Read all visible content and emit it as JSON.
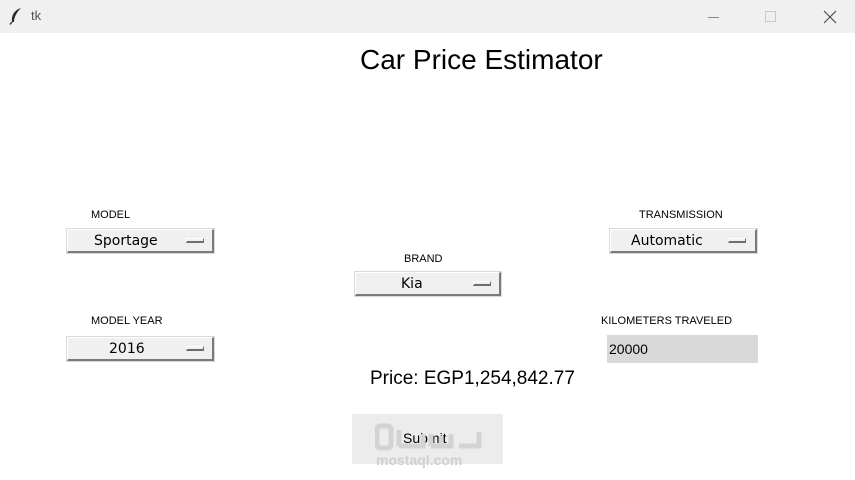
{
  "window": {
    "title": "tk"
  },
  "app": {
    "heading": "Car Price Estimator"
  },
  "fields": {
    "model": {
      "label": "MODEL",
      "value": "Sportage"
    },
    "model_year": {
      "label": "MODEL YEAR",
      "value": "2016"
    },
    "brand": {
      "label": "BRAND",
      "value": "Kia"
    },
    "transmission": {
      "label": "TRANSMISSION",
      "value": "Automatic"
    },
    "kilometers": {
      "label": "KILOMETERS TRAVELED",
      "value": "20000"
    }
  },
  "result": {
    "price_text": "Price: EGP1,254,842.77"
  },
  "actions": {
    "submit_label": "Submit"
  },
  "watermark": {
    "text": "mostaql.com",
    "logo": "مستقل"
  },
  "icons": {
    "app": "feather-icon",
    "minimize": "minimize-icon",
    "maximize": "maximize-icon",
    "close": "close-icon"
  }
}
